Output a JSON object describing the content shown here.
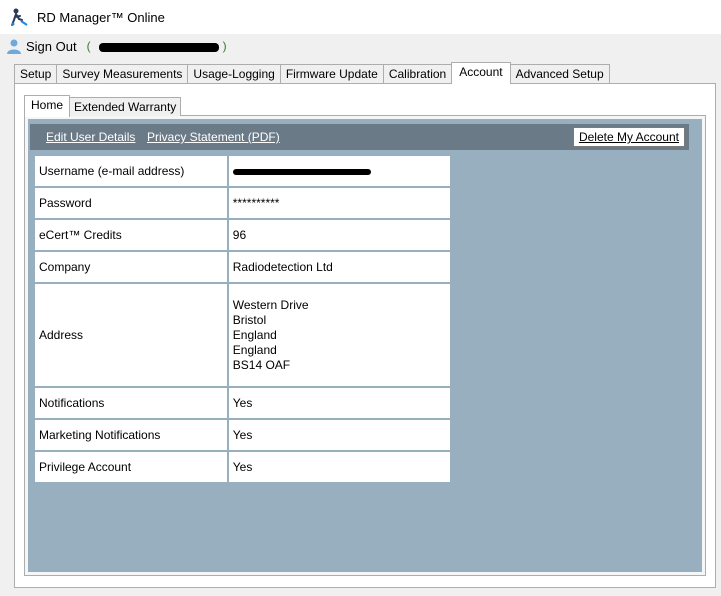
{
  "window": {
    "title": "RD Manager™ Online",
    "icon": "rd-manager-app-icon"
  },
  "signbar": {
    "signout_label": "Sign Out",
    "user_icon": "user-icon",
    "email_prefix": "(",
    "email_suffix": ")"
  },
  "main_tabs": [
    {
      "label": "Setup",
      "active": false
    },
    {
      "label": "Survey Measurements",
      "active": false
    },
    {
      "label": "Usage-Logging",
      "active": false
    },
    {
      "label": "Firmware Update",
      "active": false
    },
    {
      "label": "Calibration",
      "active": false
    },
    {
      "label": "Account",
      "active": true
    },
    {
      "label": "Advanced Setup",
      "active": false
    }
  ],
  "inner_tabs": [
    {
      "label": "Home",
      "active": true
    },
    {
      "label": "Extended Warranty",
      "active": false
    }
  ],
  "header": {
    "edit_user_details": "Edit User Details",
    "privacy_statement": "Privacy Statement (PDF)",
    "delete_account": "Delete My Account"
  },
  "account": {
    "rows": [
      {
        "label": "Username (e-mail address)",
        "value": ""
      },
      {
        "label": "Password",
        "value": "**********"
      },
      {
        "label": "eCert™ Credits",
        "value": "96"
      },
      {
        "label": "Company",
        "value": "Radiodetection Ltd"
      },
      {
        "label": "Address",
        "address_lines": [
          "Western Drive",
          "Bristol",
          "England",
          "England",
          "BS14 OAF"
        ]
      },
      {
        "label": "Notifications",
        "value": "Yes"
      },
      {
        "label": "Marketing Notifications",
        "value": "Yes"
      },
      {
        "label": "Privilege Account",
        "value": "Yes"
      }
    ]
  },
  "colors": {
    "panel_bg": "#97afbf",
    "header_strip": "#6b7a87",
    "email_green": "#2e7d32"
  }
}
